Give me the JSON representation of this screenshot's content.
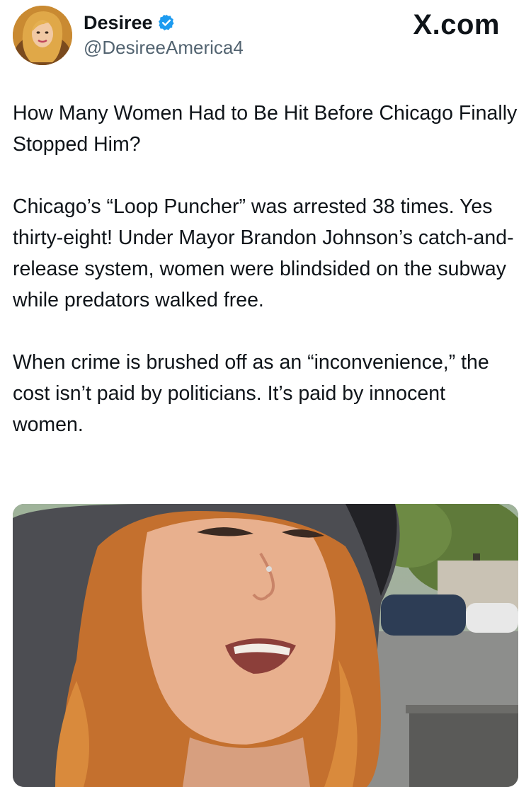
{
  "author": {
    "display_name": "Desiree",
    "handle": "@DesireeAmerica4",
    "verified": true,
    "avatar_icon": "profile-photo"
  },
  "brand": {
    "label": "X.com"
  },
  "tweet": {
    "paragraphs": [
      "How Many Women Had to Be Hit Before Chicago Finally Stopped Him?",
      "Chicago’s “Loop Puncher” was arrested 38 times. Yes thirty-eight! Under Mayor Brandon Johnson’s catch-and-release system, women were blindsided on the subway while predators walked free.",
      "When crime is brushed off as an “inconvenience,” the cost isn’t paid by politicians. It’s paid by innocent women."
    ]
  },
  "media": {
    "type": "video-thumbnail",
    "description_icon": "photo-woman-in-hood"
  },
  "colors": {
    "text": "#0f1419",
    "secondary": "#536471",
    "verified_blue": "#1d9bf0"
  }
}
